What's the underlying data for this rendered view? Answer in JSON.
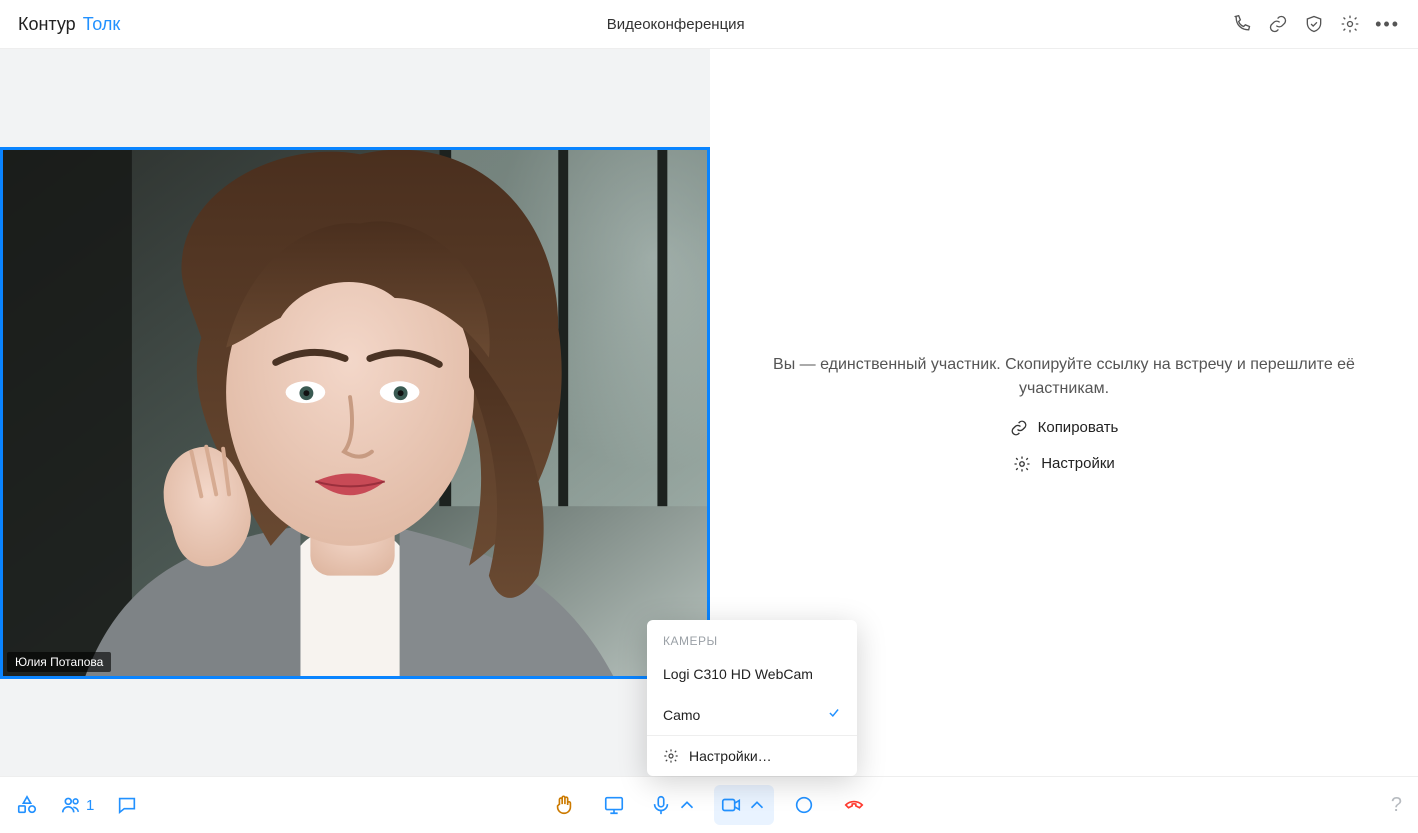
{
  "header": {
    "brand1": "Контур",
    "brand2": "Толк",
    "title": "Видеоконференция"
  },
  "video": {
    "participant_name": "Юлия Потапова"
  },
  "info": {
    "message": "Вы — единственный участник. Скопируйте ссылку на встречу и перешлите её участникам.",
    "copy_label": "Копировать",
    "settings_label": "Настройки"
  },
  "camera_popup": {
    "title": "КАМЕРЫ",
    "options": [
      {
        "label": "Logi C310 HD WebCam",
        "selected": false
      },
      {
        "label": "Camo",
        "selected": true
      }
    ],
    "settings_label": "Настройки…"
  },
  "footer": {
    "participants_count": "1",
    "help_label": "?"
  }
}
